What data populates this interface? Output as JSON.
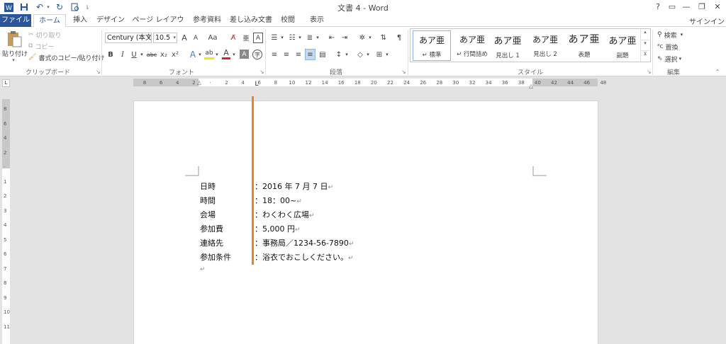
{
  "app": {
    "title": "文書 4 - Word",
    "help": "?",
    "signin": "サインイン"
  },
  "tabs": [
    "ファイル",
    "ホーム",
    "挿入",
    "デザイン",
    "ページ レイアウト",
    "参考資料",
    "差し込み文書",
    "校閲",
    "表示"
  ],
  "active_tab": "ホーム",
  "clipboard": {
    "paste": "貼り付け",
    "cut": "切り取り",
    "copy": "コピー",
    "format_painter": "書式のコピー/貼り付け",
    "label": "クリップボード"
  },
  "font": {
    "name": "Century (本文",
    "size": "10.5",
    "label": "フォント",
    "grow": "A",
    "shrink": "A",
    "case": "Aa",
    "bold": "B",
    "italic": "I",
    "underline": "U",
    "strike": "abc",
    "subscript": "x₂",
    "superscript": "x²",
    "effects": "A",
    "highlight": "ab",
    "color": "A",
    "shading": "A",
    "enclose": "字"
  },
  "paragraph": {
    "label": "段落"
  },
  "styles": {
    "label": "スタイル",
    "items": [
      {
        "preview": "あア亜",
        "name": "↵ 標準"
      },
      {
        "preview": "あア亜",
        "name": "↵ 行間詰め"
      },
      {
        "preview": "あア亜",
        "name": "見出し 1"
      },
      {
        "preview": "あア亜",
        "name": "見出し 2"
      },
      {
        "preview": "あア亜",
        "name": "表題"
      },
      {
        "preview": "あア亜",
        "name": "副題"
      }
    ]
  },
  "editing": {
    "label": "編集",
    "find": "検索",
    "replace": "置換",
    "select": "選択"
  },
  "ruler_labels": [
    "8",
    "6",
    "4",
    "2",
    "",
    "2",
    "4",
    "6",
    "8",
    "10",
    "12",
    "14",
    "16",
    "18",
    "20",
    "22",
    "24",
    "26",
    "28",
    "30",
    "32",
    "34",
    "36",
    "38",
    "40",
    "42",
    "44",
    "46",
    "48"
  ],
  "vruler_labels": [
    "8",
    "6",
    "4",
    "2",
    "",
    "1",
    "2",
    "3",
    "4",
    "5",
    "6",
    "7",
    "8",
    "9",
    "10",
    "11"
  ],
  "document": {
    "lines": [
      {
        "label": "日時",
        "value": "：2016 年 7 月 7 日"
      },
      {
        "label": "時間",
        "value": "：18：00~"
      },
      {
        "label": "会場",
        "value": "：わくわく広場"
      },
      {
        "label": "参加費",
        "value": "：5,000 円"
      },
      {
        "label": "連絡先",
        "value": "：事務局／1234-56-7890"
      },
      {
        "label": "参加条件",
        "value": "：浴衣でおこしください。"
      }
    ],
    "paragraph_mark": "↵"
  },
  "colors": {
    "accent": "#2b579a",
    "highlight_bar": "#e8822b"
  }
}
